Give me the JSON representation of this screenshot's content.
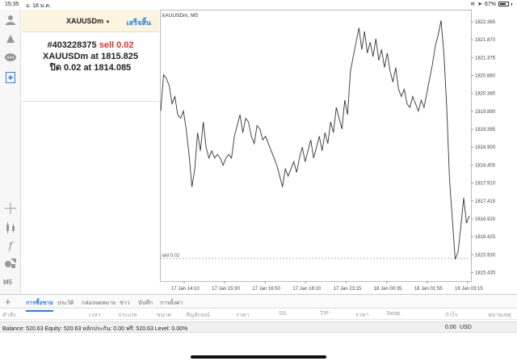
{
  "statusbar": {
    "time": "15:35",
    "date": "อ. 18 ม.ค.",
    "battery": "67%"
  },
  "toolbar": {
    "timeframe": "M5",
    "icons": [
      "account-icon",
      "signal-icon",
      "chat-icon",
      "new-order-icon",
      "crosshair-icon",
      "candles-icon",
      "indicator-icon",
      "objects-icon"
    ]
  },
  "trade": {
    "symbol": "XAUUSDm",
    "symbol_arrow": "▼",
    "done_label": "เสร็จสิ้น",
    "order_id": "#403228375",
    "order_type": "sell 0.02",
    "line2_prefix": "XAUUSDm at",
    "line2_price": "1815.825",
    "line3_prefix": "ปิด 0.02 at",
    "line3_price": "1814.085"
  },
  "chart_data": {
    "type": "line",
    "title": "XAUUSDm, M5",
    "xlabel": "",
    "ylabel": "",
    "grid": false,
    "ylim": [
      1815.2,
      1822.7
    ],
    "y_ticks": [
      "1822.365",
      "1821.870",
      "1821.375",
      "1820.880",
      "1820.385",
      "1819.890",
      "1819.395",
      "1818.900",
      "1818.405",
      "1817.910",
      "1817.415",
      "1816.920",
      "1816.425",
      "1815.930",
      "1815.435"
    ],
    "y_tick_values": [
      1822.365,
      1821.87,
      1821.375,
      1820.88,
      1820.385,
      1819.89,
      1819.395,
      1818.9,
      1818.405,
      1817.91,
      1817.415,
      1816.92,
      1816.425,
      1815.93,
      1815.435
    ],
    "x_ticks": [
      "17 Jan 14:10",
      "17 Jan 15:30",
      "17 Jan 16:50",
      "17 Jan 18:10",
      "17 Jan 23:15",
      "18 Jan 00:35",
      "18 Jan 01:55",
      "18 Jan 03:15"
    ],
    "series": [
      {
        "values": [
          1819.9,
          1820.9,
          1820.8,
          1820.6,
          1820.1,
          1820.3,
          1819.8,
          1819.7,
          1819.9,
          1819.4,
          1818.7,
          1817.8,
          1818.3,
          1819.3,
          1818.8,
          1819.6,
          1818.9,
          1818.6,
          1818.8,
          1818.6,
          1818.7,
          1818.6,
          1818.4,
          1818.6,
          1818.7,
          1818.6,
          1819.2,
          1819.5,
          1819.8,
          1819.3,
          1819.7,
          1819.6,
          1819.2,
          1819.0,
          1819.5,
          1819.4,
          1819.1,
          1819.2,
          1819.0,
          1818.8,
          1818.6,
          1818.4,
          1818.1,
          1817.8,
          1818.3,
          1818.1,
          1818.3,
          1818.5,
          1818.2,
          1818.6,
          1818.9,
          1818.5,
          1818.8,
          1819.1,
          1818.6,
          1818.9,
          1819.2,
          1818.8,
          1819.3,
          1819.0,
          1819.6,
          1819.3,
          1820.0,
          1819.7,
          1819.4,
          1820.2,
          1819.8,
          1821.0,
          1821.4,
          1821.8,
          1822.2,
          1821.6,
          1822.1,
          1821.5,
          1821.8,
          1821.4,
          1821.9,
          1821.3,
          1821.6,
          1821.1,
          1821.5,
          1821.0,
          1820.7,
          1821.1,
          1820.5,
          1820.3,
          1820.5,
          1820.1,
          1820.0,
          1820.3,
          1820.1,
          1819.9,
          1820.2,
          1820.0,
          1820.4,
          1820.8,
          1821.2,
          1821.7,
          1822.0,
          1822.4,
          1821.5,
          1820.0,
          1818.0,
          1816.9,
          1815.8,
          1816.0,
          1816.7,
          1817.5,
          1816.8,
          1817.0
        ]
      }
    ],
    "annotations": [
      {
        "text": "sell 0.02",
        "y": 1815.825
      }
    ]
  },
  "tabs": {
    "plus": "+",
    "items": [
      "การซื้อขาย",
      "ประวัติ",
      "กล่องจดหมาย",
      "ข่าว",
      "บันทึก",
      "การตั้งค่า"
    ],
    "active_index": 0
  },
  "columns": [
    "คำสั่ง",
    "เวลา",
    "ประเภท",
    "ขนาด",
    "สัญลักษณ์",
    "ราคา",
    "S/L",
    "T/P",
    "ราคา",
    "Swap",
    "กำไร",
    "หมายเหตุ"
  ],
  "balance": {
    "text": "Balance: 520.63 Equity: 520.63 หลักประกัน: 0.00 ฟรี: 520.63 Level: 0.00%",
    "profit": "0.00",
    "currency": "USD"
  },
  "colors": {
    "accent": "#2a7de1",
    "sell": "#e0302b",
    "header_bg": "#fbf5e0"
  }
}
